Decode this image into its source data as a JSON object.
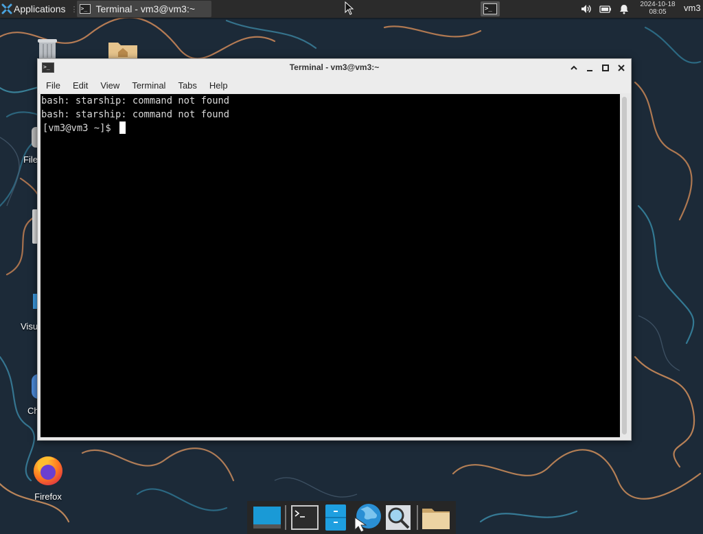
{
  "top_panel": {
    "applications_label": "Applications",
    "task_label": "Terminal - vm3@vm3:~",
    "clock_date": "2024-10-18",
    "clock_time": "08:05",
    "user": "vm3",
    "icons": [
      "applications-icon",
      "terminal-icon",
      "mouse-pointer-icon",
      "terminal-launcher-icon",
      "volume-icon",
      "battery-icon",
      "notification-bell-icon"
    ]
  },
  "desktop": {
    "icons": [
      {
        "name": "trash-icon",
        "label": ""
      },
      {
        "name": "home-folder-icon",
        "label": ""
      },
      {
        "name": "file-system-icon",
        "label": "File"
      },
      {
        "name": "drive-icon",
        "label": ""
      },
      {
        "name": "vscode-icon",
        "label": "Visu"
      },
      {
        "name": "chromium-icon",
        "label": "Ch"
      },
      {
        "name": "firefox-icon",
        "label": "Firefox"
      }
    ]
  },
  "terminal_window": {
    "title": "Terminal - vm3@vm3:~",
    "menu": [
      "File",
      "Edit",
      "View",
      "Terminal",
      "Tabs",
      "Help"
    ],
    "lines": [
      "bash: starship: command not found",
      "bash: starship: command not found"
    ],
    "prompt": "[vm3@vm3 ~]$ "
  },
  "dock": {
    "items": [
      "show-desktop-icon",
      "terminal-icon",
      "file-manager-icon",
      "web-browser-icon",
      "app-finder-icon",
      "folder-icon"
    ]
  },
  "colors": {
    "panel_bg": "#2b2b2b",
    "terminal_bg": "#000000",
    "terminal_fg": "#d8d8d8",
    "wallpaper": "#1c2a38"
  }
}
